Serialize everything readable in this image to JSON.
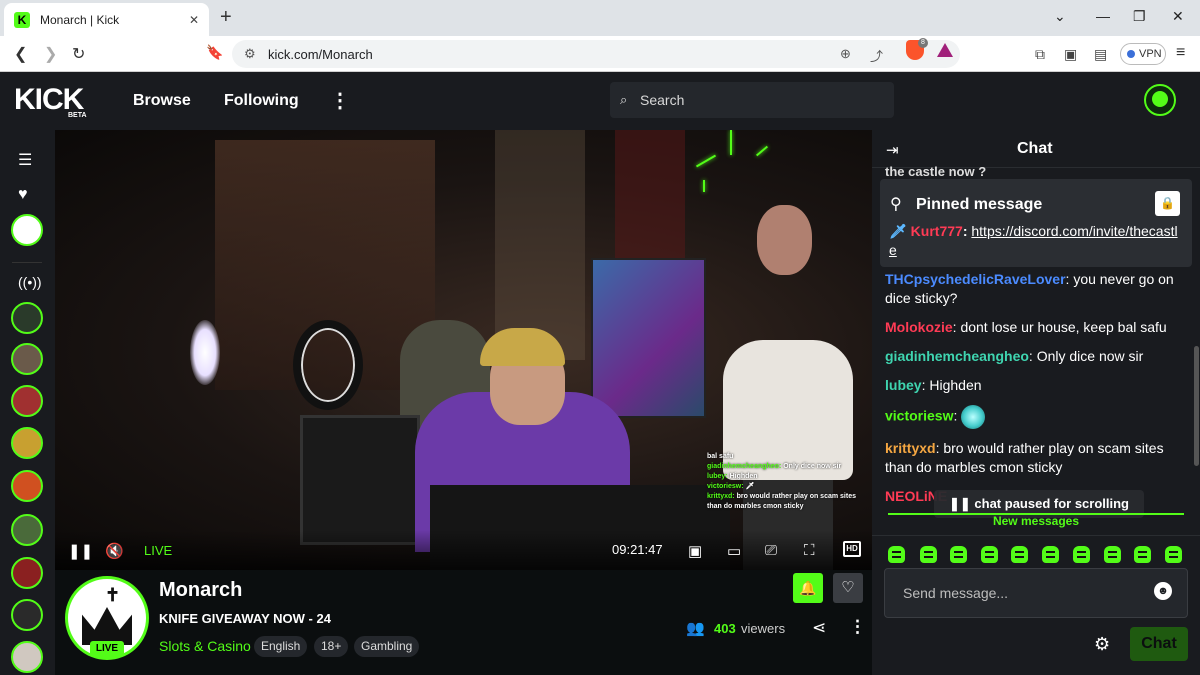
{
  "browser": {
    "tab_title": "Monarch | Kick",
    "tab_favicon_letter": "K",
    "new_tab": "+",
    "url": "kick.com/Monarch",
    "vpn_label": "VPN",
    "shields_badge": "8"
  },
  "kick": {
    "logo": "KICK",
    "logo_badge": "BETA",
    "nav": {
      "browse": "Browse",
      "following": "Following"
    },
    "search_placeholder": "Search"
  },
  "player": {
    "live_label": "LIVE",
    "time": "09:21:47",
    "quality": "HD",
    "overlay_chat": [
      {
        "user": "",
        "text": "bal safu"
      },
      {
        "user": "giadinhemcheangheo:",
        "text": " Only dice now sir"
      },
      {
        "user": "lubey:",
        "text": " Highden"
      },
      {
        "user": "victoriesw:",
        "text": " 🗡"
      },
      {
        "user": "krittyxd:",
        "text": " bro would rather play on scam sites than do marbles cmon sticky"
      }
    ]
  },
  "stream": {
    "channel_name": "Monarch",
    "live_badge": "LIVE",
    "title": "KNIFE GIVEAWAY NOW - 24",
    "category": "Slots & Casino",
    "tags": [
      "English",
      "18+",
      "Gambling"
    ],
    "viewer_count": "403",
    "viewer_label": "viewers"
  },
  "chat": {
    "title": "Chat",
    "scrolled_text": "the castle now ?",
    "pinned": {
      "title": "Pinned message",
      "user": "Kurt777",
      "link": "https://discord.com/invite/thecastle"
    },
    "messages": [
      {
        "user": "THCpsychedelicRaveLover",
        "color": "#4b8bff",
        "text": "you never go on dice sticky?"
      },
      {
        "user": "Molokozie",
        "color": "#ff3b55",
        "text": "dont lose ur house, keep bal safu"
      },
      {
        "user": "giadinhemcheangheo",
        "color": "#3fd5b0",
        "text": "Only dice now sir"
      },
      {
        "user": "lubey",
        "color": "#3fd5b0",
        "text": "Highden"
      },
      {
        "user": "victoriesw",
        "color": "#53fc18",
        "text": "",
        "emote": true
      },
      {
        "user": "krittyxd",
        "color": "#f5a742",
        "text": "bro would rather play on scam sites than do marbles cmon sticky"
      },
      {
        "user": "NEOLiNE",
        "color": "#ff3b55",
        "text": ""
      }
    ],
    "paused_label": "chat paused for scrolling",
    "new_messages_label": "New messages",
    "send_placeholder": "Send message...",
    "send_button": "Chat"
  },
  "icons": {
    "pin": "📌",
    "lock": "🔒",
    "gear": "⚙",
    "share": "⤴",
    "viewers": "👥"
  },
  "colors": {
    "accent": "#53fc18",
    "background": "#0b0e0f",
    "panel": "#191b1f"
  }
}
